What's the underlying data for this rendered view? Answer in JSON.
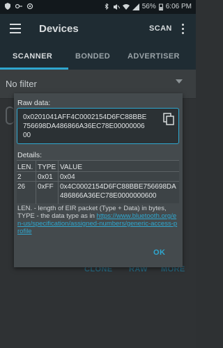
{
  "status_bar": {
    "battery": "56%",
    "time": "6:06 PM"
  },
  "app_bar": {
    "title": "Devices",
    "scan_label": "SCAN"
  },
  "tabs": [
    {
      "label": "SCANNER"
    },
    {
      "label": "BONDED"
    },
    {
      "label": "ADVERTISER"
    }
  ],
  "filter": {
    "label": "No filter"
  },
  "background_actions": [
    {
      "label": "CLONE"
    },
    {
      "label": "RAW"
    },
    {
      "label": "MORE"
    }
  ],
  "dialog": {
    "raw_label": "Raw data:",
    "raw_value": "0x0201041AFF4C0002154D6FC88BBE756698DA486866A36EC78E0000000600",
    "details_label": "Details:",
    "columns": [
      "LEN.",
      "TYPE",
      "VALUE"
    ],
    "rows": [
      {
        "len": "2",
        "type": "0x01",
        "value": "0x04"
      },
      {
        "len": "26",
        "type": "0xFF",
        "value": "0x4C0002154D6FC88BBE756698DA486866A36EC78E0000000600"
      }
    ],
    "note_prefix": "LEN. - length of EIR packet (Type + Data) in bytes, TYPE - the data type as in ",
    "note_link": "https://www.bluetooth.org/en-us/specification/assigned-numbers/generic-access-profile",
    "ok_label": "OK"
  },
  "colors": {
    "accent": "#2fa7cf",
    "appbar": "#1f2c33",
    "dialog": "#444a4d"
  }
}
